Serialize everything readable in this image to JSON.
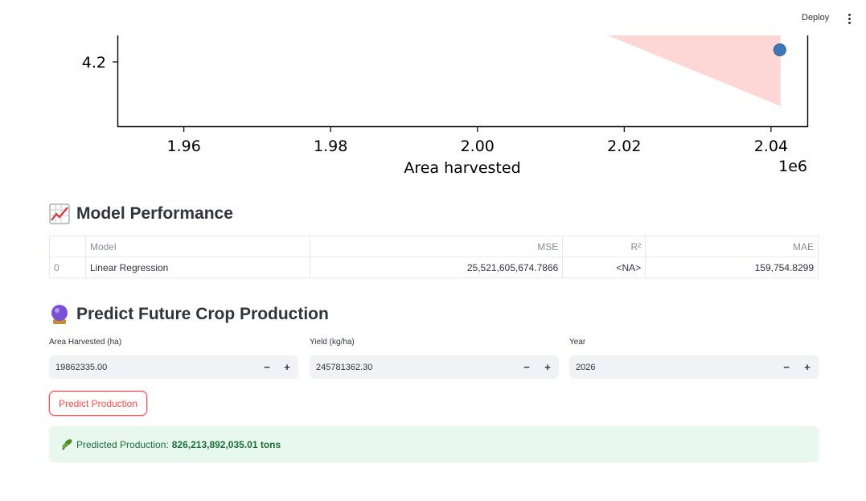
{
  "header": {
    "deploy_label": "Deploy"
  },
  "icons": {
    "menu": "more-vert-icon",
    "chart_emoji": "chart-increasing-icon",
    "predict_emoji": "crystal-ball-icon",
    "plant_emoji": "seedling-icon"
  },
  "chart_data": {
    "type": "scatter",
    "xlabel": "Area harvested",
    "x_offset_label": "1e6",
    "x_ticks": [
      1.96,
      1.98,
      2.0,
      2.02,
      2.04
    ],
    "x_tick_labels": [
      "1.96",
      "1.98",
      "2.00",
      "2.02",
      "2.04"
    ],
    "y_ticks": [
      4.2
    ],
    "y_tick_labels": [
      "4.2"
    ],
    "xlim": [
      1.951,
      2.045
    ],
    "points": [
      {
        "x": 2.0412,
        "y": 4.23
      }
    ],
    "band": [
      {
        "x": 2.0175,
        "y": 4.27
      },
      {
        "x": 2.0413,
        "y": 4.27
      },
      {
        "x": 2.0413,
        "y": 4.09
      }
    ],
    "point_color": "#3f76b4",
    "band_color": "#ffd6d6"
  },
  "performance": {
    "title": "Model Performance",
    "columns": [
      "",
      "Model",
      "MSE",
      "R²",
      "MAE"
    ],
    "rows": [
      {
        "index": "0",
        "model": "Linear Regression",
        "mse": "25,521,605,674.7866",
        "r2": "<NA>",
        "mae": "159,754.8299"
      }
    ]
  },
  "predict": {
    "title": "Predict Future Crop Production",
    "area": {
      "label": "Area Harvested (ha)",
      "value": "19862335.00"
    },
    "yield": {
      "label": "Yield (kg/ha)",
      "value": "245781362.30"
    },
    "year": {
      "label": "Year",
      "value": "2026"
    },
    "minus": "−",
    "plus": "+",
    "button_label": "Predict Production"
  },
  "result": {
    "prefix": "Predicted Production:",
    "value": "826,213,892,035.01 tons"
  },
  "colors": {
    "accent": "#ff4b4b",
    "success_bg": "#e9f8ee",
    "success_text": "#177233"
  }
}
